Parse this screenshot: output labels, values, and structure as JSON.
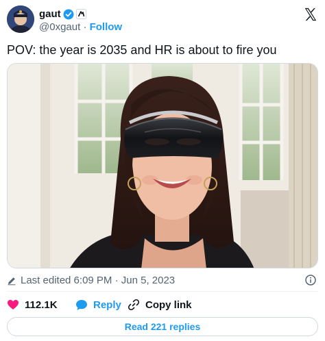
{
  "author": {
    "name": "gaut",
    "handle": "@0xgaut",
    "separator": "·",
    "follow_label": "Follow",
    "verified": true
  },
  "icons": {
    "verified": "verified-badge-icon",
    "affiliate": "affiliate-badge-icon",
    "brand": "x-logo-icon",
    "edit": "pencil-icon",
    "info": "info-icon",
    "like": "heart-icon",
    "reply": "speech-bubble-icon",
    "copy": "link-icon"
  },
  "tweet": {
    "text": "POV: the year is 2035 and HR is about to fire you"
  },
  "meta": {
    "edited_label": "Last edited 6:09 PM · Jun 5, 2023"
  },
  "actions": {
    "like_count": "112.1K",
    "reply_label": "Reply",
    "copy_label": "Copy link"
  },
  "footer": {
    "read_replies_label": "Read 221 replies"
  },
  "colors": {
    "accent": "#1d9bf0",
    "like": "#f91880",
    "text": "#0f1419",
    "muted": "#536471"
  }
}
